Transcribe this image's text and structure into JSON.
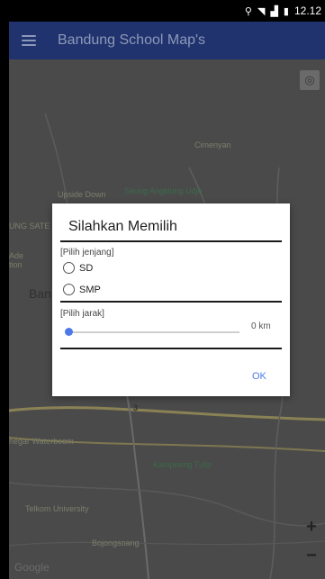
{
  "status_bar": {
    "time": "12.12",
    "icons": [
      "location-icon",
      "wifi-icon",
      "signal-icon",
      "battery-icon"
    ]
  },
  "app_bar": {
    "title": "Bandung School Map's",
    "menu_icon": "hamburger-menu-icon",
    "color": "#20336e"
  },
  "map": {
    "labels": {
      "cimenyan": "Cimenyan",
      "upside_down": "Upside Down",
      "saung": "Saung Angklung Udjo",
      "ung_sate": "UNG SATE",
      "ade": "Ade",
      "tion": "tion",
      "ban": "Ban",
      "waterboom": "hegar Waterboom",
      "kampoeng": "Kampoeng Tulip",
      "telkom": "Telkom University",
      "bojong": "Bojongsoang"
    },
    "route_badge": "3",
    "zoom_in": "+",
    "zoom_out": "−",
    "google": "Google"
  },
  "dialog": {
    "title": "Silahkan Memilih",
    "jenjang_label": "[Pilih jenjang]",
    "options": [
      "SD",
      "SMP"
    ],
    "jarak_label": "[Pilih jarak]",
    "distance_value": "0 km",
    "slider_fraction": 0.0,
    "ok_label": "OK",
    "accent": "#4d79e6"
  }
}
